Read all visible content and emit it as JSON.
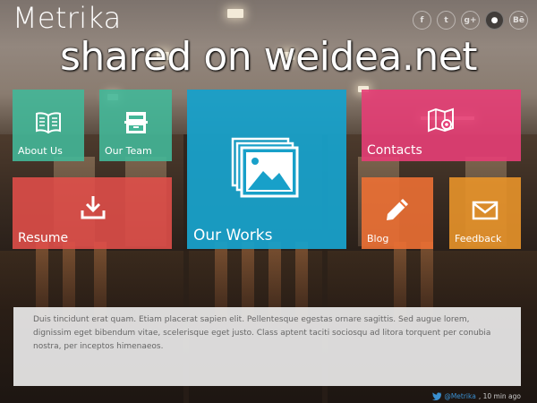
{
  "header": {
    "logo": "Metrika",
    "social_icons": [
      {
        "name": "facebook-icon",
        "glyph": "f"
      },
      {
        "name": "twitter-icon",
        "glyph": "t"
      },
      {
        "name": "google-plus-icon",
        "glyph": "g+"
      },
      {
        "name": "github-icon",
        "glyph": "●"
      },
      {
        "name": "behance-icon",
        "glyph": "Bē"
      }
    ]
  },
  "watermark": "shared on weidea.net",
  "tiles": {
    "about": {
      "label": "About Us",
      "color": "#43b798",
      "icon": "book-icon"
    },
    "team": {
      "label": "Our Team",
      "color": "#43b798",
      "icon": "cabinet-icon"
    },
    "works": {
      "label": "Our Works",
      "color": "#18a0c9",
      "icon": "gallery-icon"
    },
    "contacts": {
      "label": "Contacts",
      "color": "#e63e76",
      "icon": "map-icon"
    },
    "resume": {
      "label": "Resume",
      "color": "#e34f4a",
      "icon": "download-icon"
    },
    "blog": {
      "label": "Blog",
      "color": "#ec7034",
      "icon": "pencil-icon"
    },
    "feedback": {
      "label": "Feedback",
      "color": "#e8942a",
      "icon": "envelope-icon"
    }
  },
  "info": {
    "text": "Duis tincidunt erat quam. Etiam placerat sapien elit. Pellentesque egestas ornare sagittis. Sed augue lorem, dignissim eget bibendum vitae, scelerisque eget justo. Class aptent taciti sociosqu ad litora torquent per conubia nostra, per inceptos himenaeos."
  },
  "tweet": {
    "handle": "@Metrika",
    "time": ", 10 min ago"
  }
}
